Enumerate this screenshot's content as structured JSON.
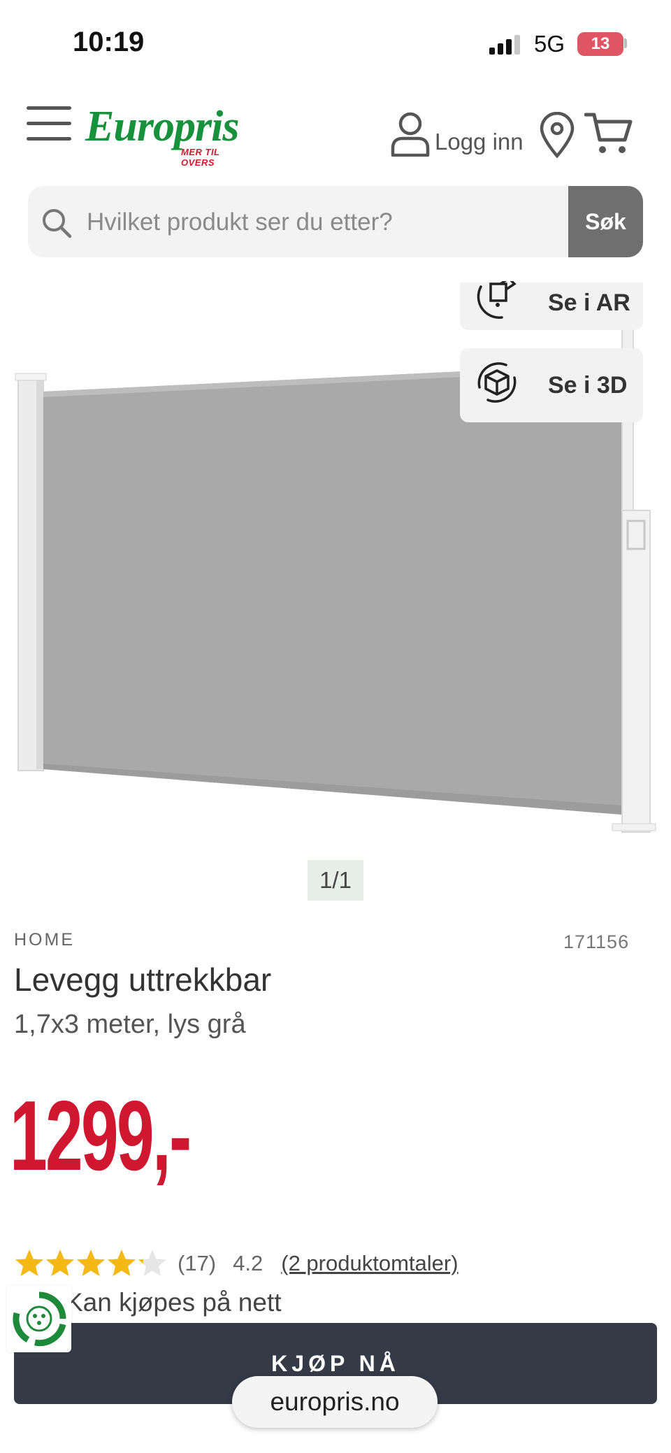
{
  "status_bar": {
    "time": "10:19",
    "network": "5G",
    "battery": "13"
  },
  "header": {
    "logo_text": "Europris",
    "logo_tagline": "MER TIL OVERS",
    "login_label": "Logg inn",
    "icons": [
      "menu-icon",
      "user-icon",
      "location-pin-icon",
      "cart-icon"
    ]
  },
  "search": {
    "placeholder": "Hvilket produkt ser du etter?",
    "button_label": "Søk"
  },
  "media": {
    "ar_label": "Se i AR",
    "view3d_label": "Se i 3D",
    "pager": "1/1"
  },
  "product": {
    "brand": "HOME",
    "sku": "171156",
    "title": "Levegg uttrekkbar",
    "subtitle": "1,7x3 meter, lys grå",
    "price": "1299,-",
    "rating_count": "(17)",
    "rating_value": "4.2",
    "rating_stars": 4.2,
    "reviews_link": "(2 produktomtaler)",
    "availability": "Kan kjøpes på nett"
  },
  "cta": {
    "buy_label": "KJØP NÅ"
  },
  "browser": {
    "url": "europris.no"
  },
  "colors": {
    "brand_green": "#17913b",
    "price_red": "#cf1730",
    "button_dark": "#353a47",
    "star_gold": "#f5b915"
  }
}
